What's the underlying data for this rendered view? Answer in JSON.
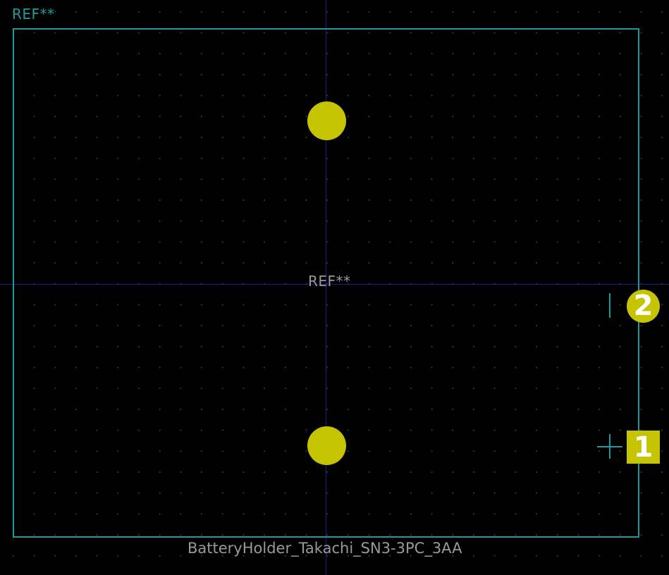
{
  "footprint": {
    "reference_fab": "REF**",
    "reference_silk": "REF**",
    "value": "BatteryHolder_Takachi_SN3-3PC_3AA"
  },
  "pads": [
    {
      "number": "2",
      "shape": "circle"
    },
    {
      "number": "1",
      "shape": "rect"
    }
  ],
  "colors": {
    "background": "#000000",
    "grid_dot": "#3a3a3a",
    "axis": "#1a1a8c",
    "courtyard": "#1f9a9a",
    "silk_text": "#1f9a9a",
    "fab_text": "#9a9a9a",
    "pad": "#c6c400",
    "pad_number": "#ffffff"
  }
}
